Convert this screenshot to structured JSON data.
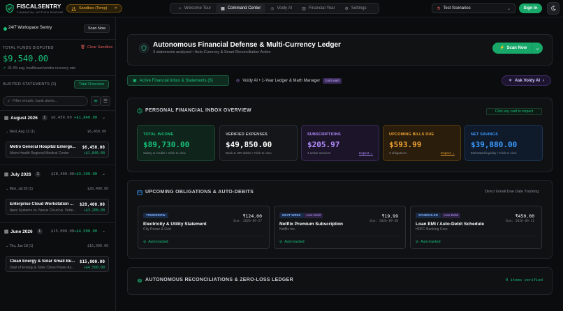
{
  "topbar": {
    "brand": "FISCALSENTRY",
    "tagline": "FINANCIAL ACTION ENGINE",
    "sandbox_label": "Sandbox (Temp)",
    "nav": [
      {
        "label": "Welcome Tour",
        "icon": "sparkle-icon"
      },
      {
        "label": "Command Center",
        "icon": "grid-icon"
      },
      {
        "label": "Voidy AI",
        "icon": "robot-icon"
      },
      {
        "label": "Financial Year",
        "icon": "bar-chart-icon"
      },
      {
        "label": "Settings",
        "icon": "gear-icon"
      }
    ],
    "active_nav": "Command Center",
    "scenario_select": "Test Scenarios",
    "sign_in": "Sign In"
  },
  "sidebar": {
    "sentry_label": "24/7 Workspace Sentry",
    "scan_now": "Scan Now",
    "total_funds_label": "TOTAL FUNDS DISPUTED",
    "clear_sandbox": "Clear Sandbox",
    "total_funds_value": "$9,540.00",
    "recovery_rate": "31.4% avg. healthcare/vendor recovery rate",
    "audited_label": "AUDITED STATEMENTS (3)",
    "total_overview": "Total Overview",
    "filter_placeholder": "Filter emails, bank alerts...",
    "months": [
      {
        "name": "August 2026",
        "count": "1",
        "total": "$6,450.00",
        "delta": "+$1,840.00",
        "day": "Wed, Aug 12",
        "day_count": "(1)",
        "day_total": "$6,450.00",
        "txn": {
          "title": "Metro General Hospital Emerge...",
          "sub": "Metro Health Regional Medical Center",
          "amount": "$6,450.00",
          "recovered": "+$1,840.00"
        }
      },
      {
        "name": "July 2026",
        "count": "1",
        "total": "$28,400.00",
        "delta": "+$3,200.00",
        "day": "Mon, Jul 20",
        "day_count": "(1)",
        "day_total": "$28,400.00",
        "txn": {
          "title": "Enterprise Cloud Workstation ...",
          "sub": "Apex Systems vs. Nexus Cloud vs. Verte...",
          "amount": "$28,400.00",
          "recovered": "+$3,200.00"
        }
      },
      {
        "name": "June 2026",
        "count": "1",
        "total": "$15,000.00",
        "delta": "+$4,500.00",
        "day": "Thu, Jun 18",
        "day_count": "(1)",
        "day_total": "$15,000.00",
        "txn": {
          "title": "Clean Energy & Solar Small Bu...",
          "sub": "Dept of Energy & State Clean Power Au...",
          "amount": "$15,000.00",
          "recovered": "+$4,500.00"
        }
      }
    ]
  },
  "hero": {
    "title": "Autonomous Financial Defense & Multi-Currency Ledger",
    "subtitle": "3 statements analyzed • Auto-Currency & Smart Reconciliation Active",
    "scan_now": "Scan Now"
  },
  "tabs": {
    "inbox": "Active Financial Inbox & Statements (3)",
    "voidy": "Voidy AI • 1-Year Ledger & Math Manager",
    "voidy_badge": "Gold Math",
    "ask_voidy": "Ask Voidy AI"
  },
  "inbox_overview": {
    "title": "PERSONAL FINANCIAL INBOX OVERVIEW",
    "hint": "Click any card to inspect",
    "cards": [
      {
        "label": "TOTAL INCOME",
        "value": "$89,730.00",
        "desc": "Salary & credits • Click to view",
        "inspect": "",
        "color": "#18c07a",
        "bg": "#0f241b",
        "border": "#1d4a35"
      },
      {
        "label": "VERIFIED EXPENSES",
        "value": "$49,850.00",
        "desc": "Bank & UPI debits • Click to view",
        "inspect": "",
        "color": "#c9cdd1",
        "bg": "#141619",
        "border": "#2b2f34"
      },
      {
        "label": "SUBSCRIPTIONS",
        "value": "$205.97",
        "desc": "4 active services",
        "inspect": "Inspect →",
        "color": "#b48cff",
        "bg": "#1c1529",
        "border": "#3a2b57"
      },
      {
        "label": "UPCOMING BILLS DUE",
        "value": "$593.99",
        "desc": "3 obligations",
        "inspect": "Inspect →",
        "color": "#f2a533",
        "bg": "#2a1d0b",
        "border": "#5a3d14"
      },
      {
        "label": "NET SAVINGS",
        "value": "$39,880.00",
        "desc": "Estimated liquidity • Click to view",
        "inspect": "",
        "color": "#3b9cff",
        "bg": "#0f1a2b",
        "border": "#1d3657"
      }
    ]
  },
  "obligations": {
    "title": "UPCOMING OBLIGATIONS & AUTO-DEBITS",
    "direct_gmail": "Direct Gmail Due Date Tracking",
    "items": [
      {
        "tag": "TOMORROW",
        "auto_debit": "",
        "name": "Electricity & Utility Statement",
        "provider": "City Power & Grid",
        "amount": "₹124.00",
        "due": "Due: 2026-09-27",
        "tracked": "Auto-tracked"
      },
      {
        "tag": "NEXT WEEK",
        "auto_debit": "Auto-Debit",
        "name": "Netflix Premium Subscription",
        "provider": "Netflix Inc.",
        "amount": "₹19.99",
        "due": "Due: 2026-09-30",
        "tracked": "Auto-tracked"
      },
      {
        "tag": "SCHEDULED",
        "auto_debit": "Auto-Debit",
        "name": "Loan EMI / Auto-Debit Schedule",
        "provider": "HDFC Banking Corp",
        "amount": "₹450.00",
        "due": "Due: 2026-09-11",
        "tracked": "Auto-tracked"
      }
    ]
  },
  "reconciliations": {
    "title": "AUTONOMOUS RECONCILIATIONS & ZERO-LOSS LEDGER",
    "verified": "0 items verified"
  }
}
